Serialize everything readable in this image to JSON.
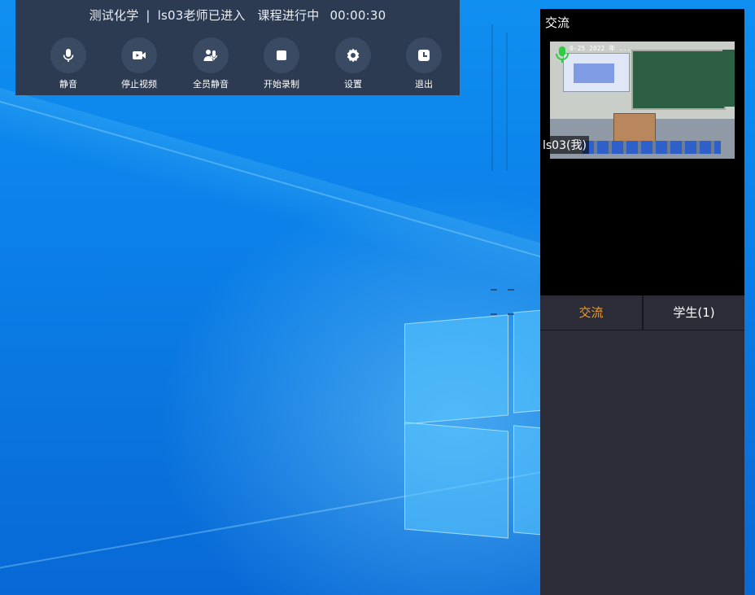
{
  "toolbar": {
    "course": "测试化学",
    "separator": "|",
    "teacher_status": "ls03老师已进入",
    "course_status": "课程进行中",
    "elapsed": "00:00:30",
    "buttons": [
      {
        "label": "静音",
        "icon": "microphone-icon"
      },
      {
        "label": "停止视频",
        "icon": "video-camera-icon"
      },
      {
        "label": "全员静音",
        "icon": "all-mute-users-icon"
      },
      {
        "label": "开始录制",
        "icon": "record-stop-icon"
      },
      {
        "label": "设置",
        "icon": "gear-icon"
      },
      {
        "label": "退出",
        "icon": "exit-clock-icon"
      }
    ]
  },
  "panel": {
    "title": "交流",
    "video": {
      "overlay_timestamp": "0-25 2022 年 ...",
      "name_tag": "ls03(我)",
      "mic_status_color": "#2ecc40"
    },
    "tabs": [
      {
        "label": "交流",
        "active": true
      },
      {
        "label": "学生(1)",
        "active": false
      }
    ]
  },
  "colors": {
    "active_tab": "#f39b22",
    "toolbar_bg": "#2c3b52",
    "panel_bg": "#2b2c37"
  }
}
